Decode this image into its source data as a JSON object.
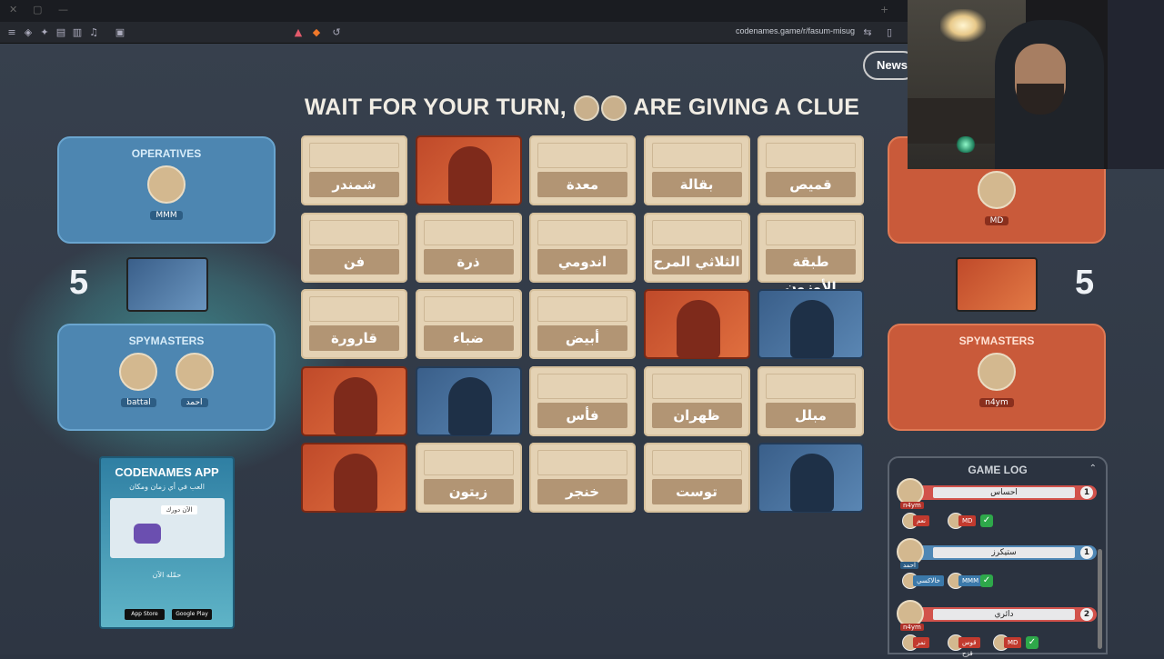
{
  "browser": {
    "url": "codenames.game/r/fasum-misug",
    "icons": [
      "menu-icon",
      "shield-icon",
      "extensions-icon",
      "reader-icon",
      "sidebar-icon",
      "music-icon",
      "tab-icon"
    ]
  },
  "page": {
    "news_label": "News",
    "banner_left": "WAIT FOR YOUR TURN,",
    "banner_right": "ARE GIVING A CLUE",
    "banner_names": [
      "battal",
      "احمد"
    ]
  },
  "blue_team": {
    "operatives_title": "OPERATIVES",
    "operatives": [
      "MMM"
    ],
    "score": "5",
    "spymasters_title": "SPYMASTERS",
    "spymasters": [
      "battal",
      "احمد"
    ]
  },
  "red_team": {
    "operatives": [
      "MD"
    ],
    "score": "5",
    "spymasters_title": "SPYMASTERS",
    "spymasters": [
      "n4ym"
    ]
  },
  "board": {
    "cards": [
      [
        "شمندر",
        "#red",
        "معدة",
        "بقالة",
        "قميص"
      ],
      [
        "فن",
        "ذرة",
        "اندومي",
        "الثلاثي المرح",
        "طبقة الأوزون"
      ],
      [
        "قارورة",
        "ضباء",
        "أبيض",
        "#red",
        "#blue"
      ],
      [
        "#red",
        "#blue",
        "فأس",
        "ظهران",
        "مبلل"
      ],
      [
        "#red",
        "زيتون",
        "خنجر",
        "توست",
        "#blue"
      ]
    ]
  },
  "app_promo": {
    "title": "CODENAMES APP",
    "subtitle": "العب في أي زمان ومكان",
    "image_label": "الآن دورك",
    "cta": "حمّله الآن",
    "store1": "App Store",
    "store2": "Google Play"
  },
  "game_log": {
    "title": "GAME LOG",
    "entries": [
      {
        "team": "red",
        "player": "n4ym",
        "clue": "احساس",
        "number": "1",
        "guesses": [
          {
            "tag": "نعم",
            "team": "red"
          },
          {
            "tag": "MD",
            "team": "red"
          }
        ]
      },
      {
        "team": "blue",
        "player": "احمد",
        "clue": "ستيكرز",
        "number": "1",
        "guesses": [
          {
            "tag": "خالاكسي",
            "team": "blue"
          },
          {
            "tag": "MMM",
            "team": "blue"
          }
        ]
      },
      {
        "team": "red",
        "player": "n4ym",
        "clue": "دائري",
        "number": "2",
        "guesses": [
          {
            "tag": "نمر",
            "team": "red"
          },
          {
            "tag": "قوس قزح",
            "team": "red"
          },
          {
            "tag": "MD",
            "team": "red"
          }
        ]
      }
    ]
  },
  "colors": {
    "blue": "#4d86b1",
    "red": "#c95a3a",
    "card": "#e4d2b4",
    "background": "#2c3441"
  }
}
